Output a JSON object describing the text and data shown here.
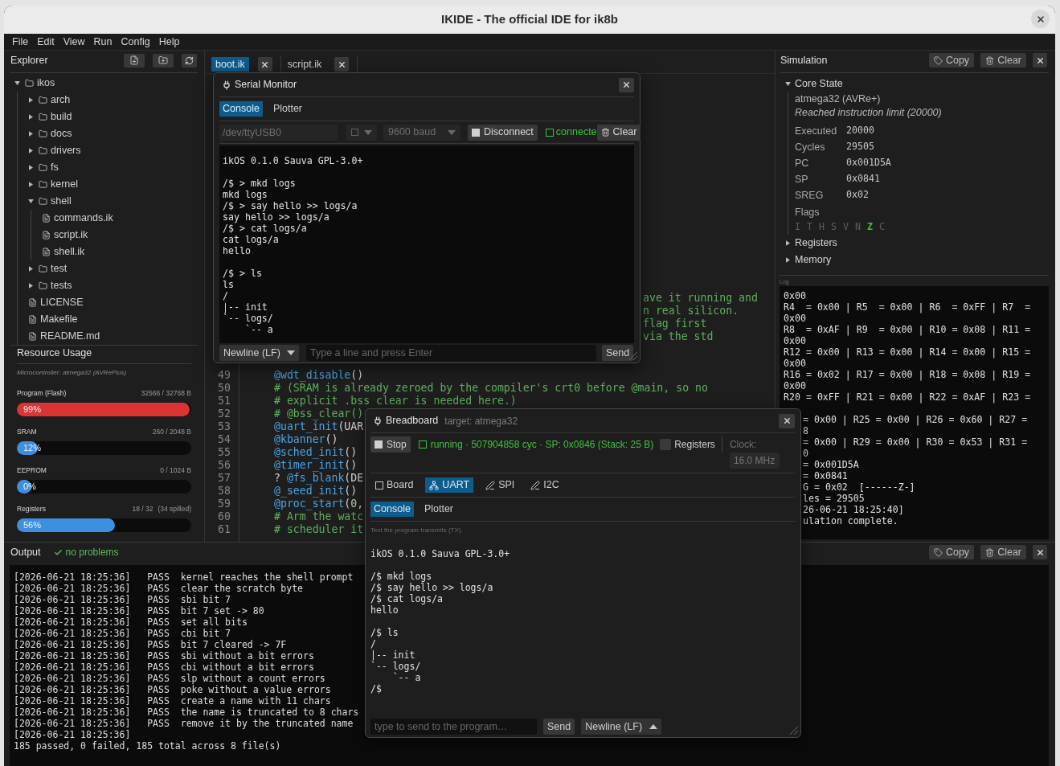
{
  "window": {
    "title": "IKIDE - The official IDE for ik8b"
  },
  "menu": [
    "File",
    "Edit",
    "View",
    "Run",
    "Config",
    "Help"
  ],
  "explorer": {
    "title": "Explorer",
    "tree": [
      {
        "name": "ikos",
        "kind": "folder",
        "expanded": true,
        "children": [
          {
            "name": "arch",
            "kind": "folder",
            "expanded": false
          },
          {
            "name": "build",
            "kind": "folder",
            "expanded": false
          },
          {
            "name": "docs",
            "kind": "folder",
            "expanded": false
          },
          {
            "name": "drivers",
            "kind": "folder",
            "expanded": false
          },
          {
            "name": "fs",
            "kind": "folder",
            "expanded": false
          },
          {
            "name": "kernel",
            "kind": "folder",
            "expanded": false
          },
          {
            "name": "shell",
            "kind": "folder",
            "expanded": true,
            "children": [
              {
                "name": "commands.ik",
                "kind": "file"
              },
              {
                "name": "script.ik",
                "kind": "file"
              },
              {
                "name": "shell.ik",
                "kind": "file"
              }
            ]
          },
          {
            "name": "test",
            "kind": "folder",
            "expanded": false
          },
          {
            "name": "tests",
            "kind": "folder",
            "expanded": false
          },
          {
            "name": "LICENSE",
            "kind": "file"
          },
          {
            "name": "Makefile",
            "kind": "file"
          },
          {
            "name": "README.md",
            "kind": "file"
          }
        ]
      }
    ]
  },
  "resources": {
    "title": "Resource Usage",
    "microcontroller": "Microcontroller: atmega32 (AVRePlus)",
    "meters": [
      {
        "label": "Program (Flash)",
        "value": "32566 / 32768 B",
        "level": 0.99,
        "reading": "99%"
      },
      {
        "label": "SRAM",
        "value": "260 / 2048 B",
        "level": 0.12,
        "reading": "12%"
      },
      {
        "label": "EEPROM",
        "value": "0 / 1024 B",
        "level": 0,
        "reading": "0%"
      },
      {
        "label": "Registers",
        "value": "18 / 32",
        "note": "(34 spilled)",
        "level": 0.56,
        "reading": "56%"
      }
    ]
  },
  "editor": {
    "tabs": [
      {
        "label": "boot.ik",
        "selected": true
      },
      {
        "label": "script.ik",
        "selected": false
      }
    ],
    "overflow_comments": [
      "ave it running and",
      "n real silicon.",
      "flag first",
      "via the std"
    ],
    "lines": [
      {
        "number": "49",
        "tokens": [
          {
            "kind": "call",
            "text": "@wdt_disable"
          },
          {
            "kind": "plain",
            "text": "()"
          }
        ]
      },
      {
        "number": "50",
        "tokens": [
          {
            "kind": "comment",
            "text": "# (SRAM is already zeroed by the compiler's crt0 before @main, so no"
          }
        ]
      },
      {
        "number": "51",
        "tokens": [
          {
            "kind": "comment",
            "text": "# explicit .bss clear is needed here.)"
          }
        ]
      },
      {
        "number": "52",
        "tokens": [
          {
            "kind": "comment",
            "text": "# @bss_clear()"
          }
        ]
      },
      {
        "number": "53",
        "tokens": [
          {
            "kind": "call",
            "text": "@uart_init"
          },
          {
            "kind": "plain",
            "text": "(UAR"
          }
        ]
      },
      {
        "number": "54",
        "tokens": [
          {
            "kind": "call",
            "text": "@kbanner"
          },
          {
            "kind": "plain",
            "text": "()"
          }
        ]
      },
      {
        "number": "55",
        "tokens": [
          {
            "kind": "call",
            "text": "@sched_init"
          },
          {
            "kind": "plain",
            "text": "()"
          }
        ]
      },
      {
        "number": "56",
        "tokens": [
          {
            "kind": "call",
            "text": "@timer_init"
          },
          {
            "kind": "plain",
            "text": "()"
          }
        ]
      },
      {
        "number": "57",
        "tokens": [
          {
            "kind": "plain",
            "text": "? "
          },
          {
            "kind": "call",
            "text": "@fs_blank"
          },
          {
            "kind": "plain",
            "text": "(DE"
          }
        ]
      },
      {
        "number": "58",
        "tokens": [
          {
            "kind": "call",
            "text": "@_seed_init"
          },
          {
            "kind": "plain",
            "text": "()"
          }
        ]
      },
      {
        "number": "59",
        "tokens": [
          {
            "kind": "call",
            "text": "@proc_start"
          },
          {
            "kind": "plain",
            "text": "("
          },
          {
            "kind": "number",
            "text": "0"
          },
          {
            "kind": "plain",
            "text": ","
          }
        ]
      },
      {
        "number": "60",
        "tokens": [
          {
            "kind": "comment",
            "text": "# Arm the watc"
          }
        ]
      },
      {
        "number": "61",
        "tokens": [
          {
            "kind": "comment",
            "text": "# scheduler it"
          }
        ]
      }
    ]
  },
  "serial_monitor": {
    "title": "Serial Monitor",
    "tabs": [
      {
        "label": "Console",
        "selected": true
      },
      {
        "label": "Plotter",
        "selected": false
      }
    ],
    "port": {
      "value": "/dev/ttyUSB0",
      "disabled": true
    },
    "mode_select": {
      "disabled": true
    },
    "baud": {
      "value": "9600 baud",
      "disabled": true
    },
    "disconnect": "Disconnect",
    "status": {
      "text": "connecte",
      "kind": "connected"
    },
    "clear": "Clear",
    "console": "ikOS 0.1.0 Sauva GPL-3.0+\n\n/$ > mkd logs\nmkd logs\n/$ > say hello >> logs/a\nsay hello >> logs/a\n/$ > cat logs/a\ncat logs/a\nhello\n\n/$ > ls\nls\n/\n|-- init\n`-- logs/\n    `-- a",
    "line_ending": "Newline (LF)",
    "input": {
      "placeholder": "Type a line and press Enter"
    },
    "send": "Send"
  },
  "simulation": {
    "title": "Simulation",
    "copy": "Copy",
    "clear": "Clear",
    "core_state": {
      "label": "Core State",
      "expanded": true,
      "device": "atmega32 (AVRe+)",
      "message": "Reached instruction limit (20000)",
      "fields": [
        {
          "label": "Executed",
          "value": "20000"
        },
        {
          "label": "Cycles",
          "value": "29505"
        },
        {
          "label": "PC",
          "value": "0x001D5A"
        },
        {
          "label": "SP",
          "value": "0x0841"
        },
        {
          "label": "SREG",
          "value": "0x02"
        }
      ],
      "flags_label": "Flags",
      "flags": [
        {
          "label": "I",
          "on": false
        },
        {
          "label": "T",
          "on": false
        },
        {
          "label": "H",
          "on": false
        },
        {
          "label": "S",
          "on": false
        },
        {
          "label": "V",
          "on": false
        },
        {
          "label": "N",
          "on": false
        },
        {
          "label": "Z",
          "on": true
        },
        {
          "label": "C",
          "on": false
        }
      ]
    },
    "sections": [
      {
        "label": "Registers",
        "expanded": false
      },
      {
        "label": "Memory",
        "expanded": false
      }
    ],
    "log_label": "Log",
    "log": [
      {
        "kind": "full",
        "text": "0x00"
      },
      {
        "kind": "full",
        "text": "R4  = 0x00 | R5  = 0x00 | R6  = 0xFF | R7  ="
      },
      {
        "kind": "full",
        "text": "0x00"
      },
      {
        "kind": "full",
        "text": "R8  = 0xAF | R9  = 0x00 | R10 = 0x08 | R11 ="
      },
      {
        "kind": "full",
        "text": "0x00"
      },
      {
        "kind": "full",
        "text": "R12 = 0x00 | R13 = 0x00 | R14 = 0x00 | R15 ="
      },
      {
        "kind": "full",
        "text": "0x00"
      },
      {
        "kind": "full",
        "text": "R16 = 0x02 | R17 = 0x00 | R18 = 0x08 | R19 ="
      },
      {
        "kind": "full",
        "text": "0x00"
      },
      {
        "kind": "full",
        "text": "R20 = 0xFF | R21 = 0x00 | R22 = 0xAF | R23 ="
      },
      {
        "kind": "clipped",
        "text": "= 0x00 | R25 = 0x00 | R26 = 0x60 | R27 ="
      },
      {
        "kind": "clipped",
        "text": "8"
      },
      {
        "kind": "clipped",
        "text": "= 0x00 | R29 = 0x00 | R30 = 0x53 | R31 ="
      },
      {
        "kind": "clipped",
        "text": "0"
      },
      {
        "kind": "clipped",
        "text": "= 0x001D5A"
      },
      {
        "kind": "clipped",
        "text": "= 0x0841"
      },
      {
        "kind": "clipped",
        "text": "G = 0x02  [------Z-]"
      },
      {
        "kind": "clipped",
        "text": "les = 29505"
      },
      {
        "kind": "clipped",
        "text": "26-06-21 18:25:40]"
      },
      {
        "kind": "clipped",
        "text": "ulation complete."
      }
    ]
  },
  "output": {
    "title": "Output",
    "status": {
      "text": "no problems",
      "kind": "ok"
    },
    "copy": "Copy",
    "clear": "Clear",
    "rows": [
      {
        "time": "[2026-06-21 18:25:36]",
        "status": "PASS",
        "message": "kernel reaches the shell prompt"
      },
      {
        "time": "[2026-06-21 18:25:36]",
        "status": "PASS",
        "message": "clear the scratch byte"
      },
      {
        "time": "[2026-06-21 18:25:36]",
        "status": "PASS",
        "message": "sbi bit 7"
      },
      {
        "time": "[2026-06-21 18:25:36]",
        "status": "PASS",
        "message": "bit 7 set -> 80"
      },
      {
        "time": "[2026-06-21 18:25:36]",
        "status": "PASS",
        "message": "set all bits"
      },
      {
        "time": "[2026-06-21 18:25:36]",
        "status": "PASS",
        "message": "cbi bit 7"
      },
      {
        "time": "[2026-06-21 18:25:36]",
        "status": "PASS",
        "message": "bit 7 cleared -> 7F"
      },
      {
        "time": "[2026-06-21 18:25:36]",
        "status": "PASS",
        "message": "sbi without a bit errors"
      },
      {
        "time": "[2026-06-21 18:25:36]",
        "status": "PASS",
        "message": "cbi without a bit errors"
      },
      {
        "time": "[2026-06-21 18:25:36]",
        "status": "PASS",
        "message": "slp without a count errors"
      },
      {
        "time": "[2026-06-21 18:25:36]",
        "status": "PASS",
        "message": "poke without a value errors"
      },
      {
        "time": "[2026-06-21 18:25:36]",
        "status": "PASS",
        "message": "create a name with 11 chars"
      },
      {
        "time": "[2026-06-21 18:25:36]",
        "status": "PASS",
        "message": "the name is truncated to 8 chars"
      },
      {
        "time": "[2026-06-21 18:25:36]",
        "status": "PASS",
        "message": "remove it by the truncated name"
      },
      {
        "time": "[2026-06-21 18:25:36]"
      }
    ],
    "summary": "185 passed, 0 failed, 185 total across 8 file(s)"
  },
  "breadboard": {
    "title": "Breadboard",
    "target": "target: atmega32",
    "stop": "Stop",
    "status": {
      "text": "running · 507904858 cyc · SP: 0x0846 (Stack: 25 B)",
      "kind": "running"
    },
    "registers_toggle": {
      "label": "Registers",
      "checked": false
    },
    "clock": {
      "label": "Clock:",
      "value": "16.0 MHz",
      "disabled": true
    },
    "tabs": [
      {
        "label": "Board",
        "kind": "board",
        "selected": false
      },
      {
        "label": "UART",
        "kind": "uart",
        "selected": true
      },
      {
        "label": "SPI",
        "kind": "spi",
        "selected": false
      },
      {
        "label": "I2C",
        "kind": "i2c",
        "selected": false
      }
    ],
    "subtabs": [
      {
        "label": "Console",
        "selected": true
      },
      {
        "label": "Plotter",
        "selected": false
      }
    ],
    "hint": "Text the program transmits (TX).",
    "console": "ikOS 0.1.0 Sauva GPL-3.0+\n\n/$ mkd logs\n/$ say hello >> logs/a\n/$ cat logs/a\nhello\n\n/$ ls\n/\n|-- init\n`-- logs/\n    `-- a\n/$",
    "input": {
      "placeholder": "type to send to the program…"
    },
    "send": "Send",
    "line_ending": "Newline (LF)"
  }
}
